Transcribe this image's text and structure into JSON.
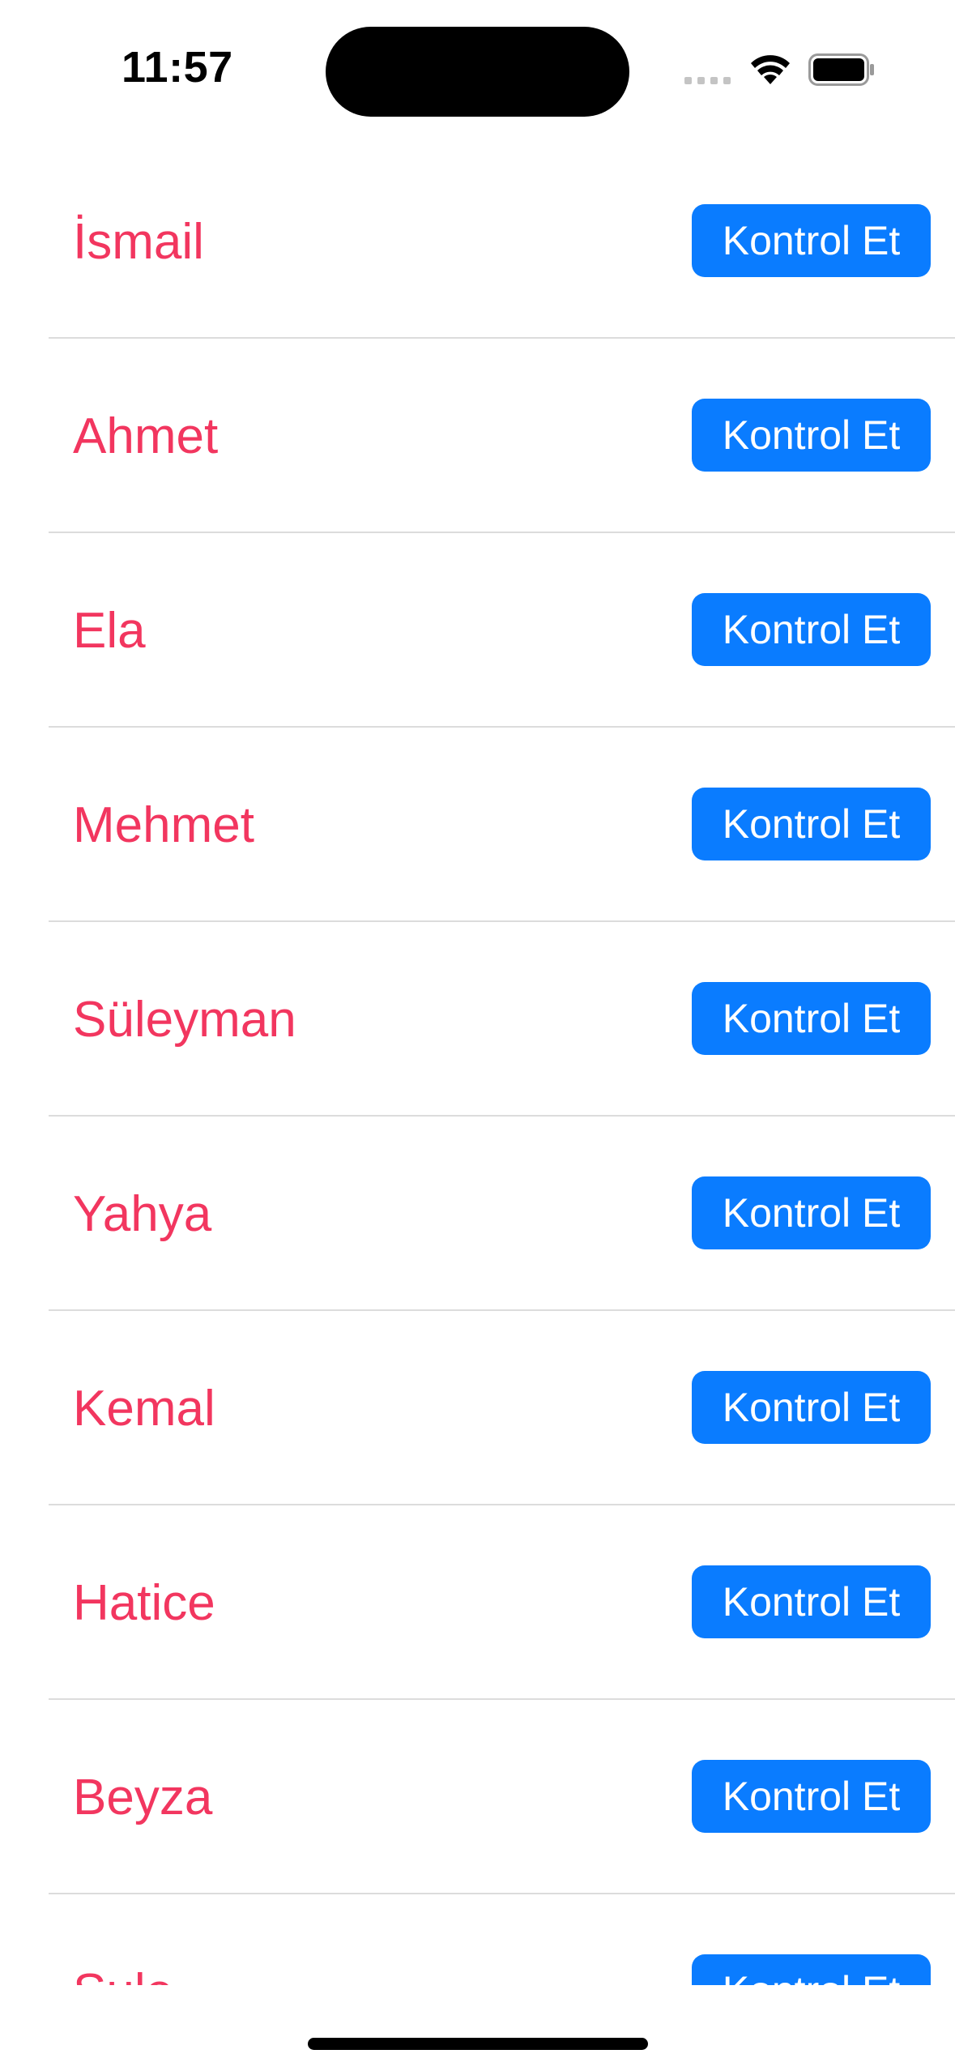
{
  "status_bar": {
    "time": "11:57",
    "icons": [
      "cellular-signal-icon",
      "wifi-icon",
      "battery-icon"
    ]
  },
  "list": {
    "button_color": "#0a7cff",
    "name_color": "#f2365f",
    "items": [
      {
        "name": "İsmail",
        "button": "Kontrol Et"
      },
      {
        "name": "Ahmet",
        "button": "Kontrol Et"
      },
      {
        "name": "Ela",
        "button": "Kontrol Et"
      },
      {
        "name": "Mehmet",
        "button": "Kontrol Et"
      },
      {
        "name": "Süleyman",
        "button": "Kontrol Et"
      },
      {
        "name": "Yahya",
        "button": "Kontrol Et"
      },
      {
        "name": "Kemal",
        "button": "Kontrol Et"
      },
      {
        "name": "Hatice",
        "button": "Kontrol Et"
      },
      {
        "name": "Beyza",
        "button": "Kontrol Et"
      },
      {
        "name": "Şule",
        "button": "Kontrol Et"
      }
    ]
  }
}
